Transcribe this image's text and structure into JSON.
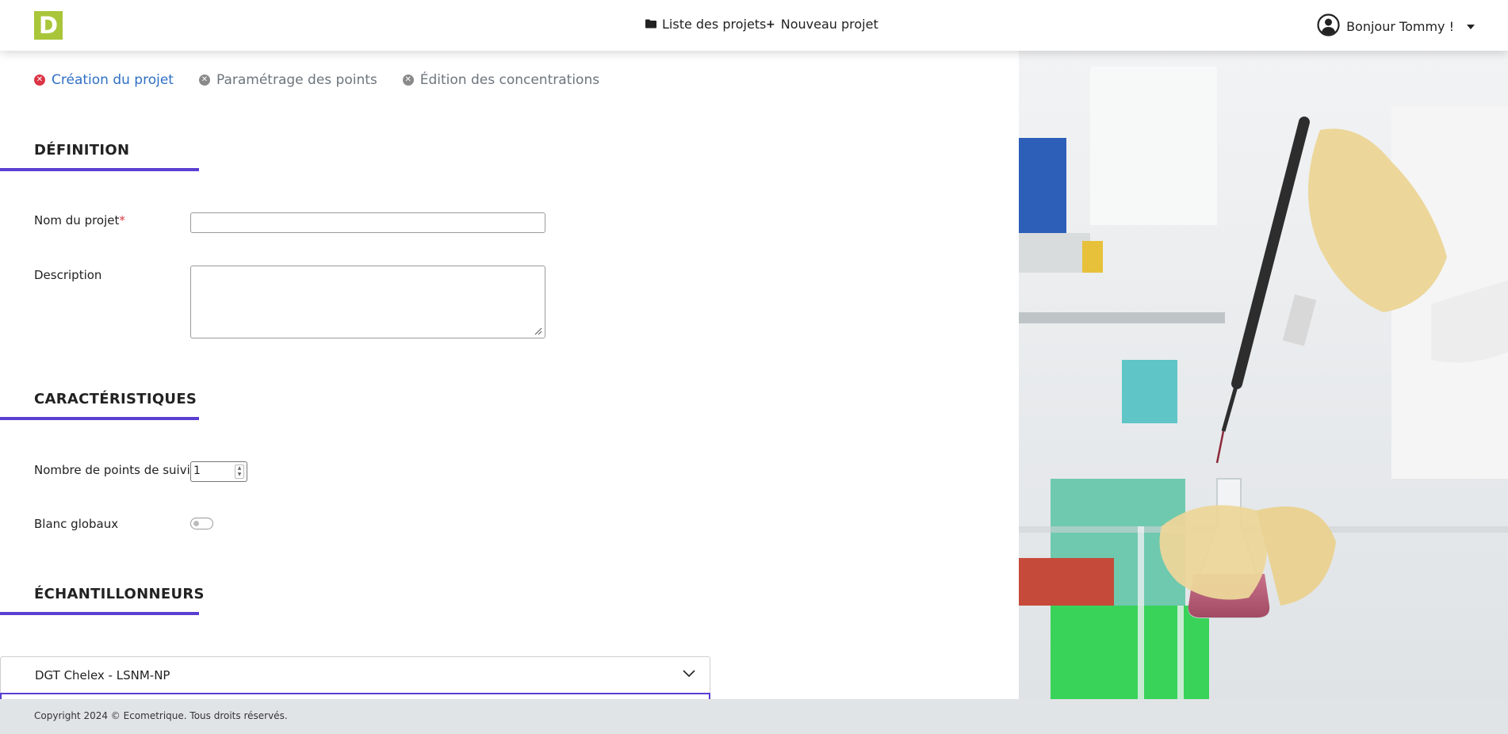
{
  "header": {
    "logo": "D",
    "nav": {
      "projects_label": "Liste des projets",
      "new_project_label": "Nouveau projet"
    },
    "user_greeting": "Bonjour Tommy !",
    "icons": {
      "projects": "folder-icon",
      "new_project": "plus-icon",
      "user": "user-circle-icon",
      "menu": "caret-down-icon"
    }
  },
  "steps": [
    {
      "label": "Création du projet",
      "active": true
    },
    {
      "label": "Paramétrage des points",
      "active": false
    },
    {
      "label": "Édition des concentrations",
      "active": false
    }
  ],
  "sections": {
    "definition": "DÉFINITION",
    "characteristics": "CARACTÉRISTIQUES",
    "samplers": "ÉCHANTILLONNEURS"
  },
  "form": {
    "project_name_label": "Nom du projet",
    "required_mark": "*",
    "project_name_value": "",
    "description_label": "Description",
    "description_value": "",
    "points_label": "Nombre de points de suivi",
    "points_value": "1",
    "blank_label": "Blanc globaux",
    "blank_enabled": false,
    "sampler_selected": "DGT Chelex - LSNM-NP"
  },
  "image": {
    "subject": "laboratory-pipette-photo"
  },
  "footer": {
    "copyright": "Copyright 2024 © Ecometrique. Tous droits réservés."
  },
  "colors": {
    "brand": "#a9c63a",
    "accent": "#5a3fd1",
    "active_step": "#2f6fc4",
    "error": "#dc3545",
    "footer_bg": "#e1e4e7"
  }
}
